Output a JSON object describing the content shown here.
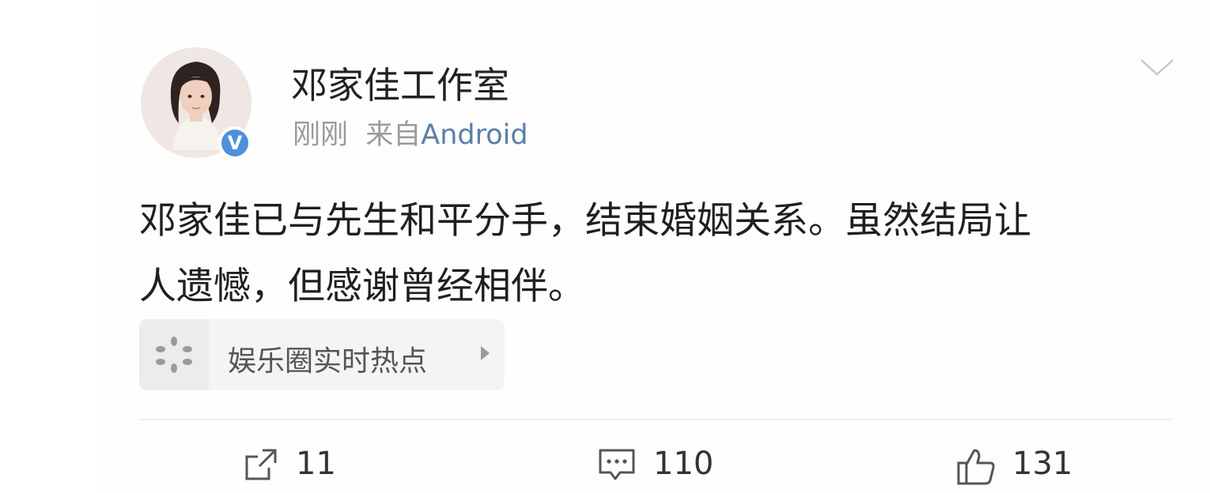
{
  "post": {
    "author": "邓家佳工作室",
    "time": "刚刚",
    "source_prefix": "来自",
    "source": "Android",
    "verified_mark": "V",
    "content_line1": "邓家佳已与先生和平分手，结束婚姻关系。虽然结局让",
    "content_line2": "人遗憾，但感谢曾经相伴。",
    "topic": "娱乐圈实时热点"
  },
  "actions": {
    "repost_count": "11",
    "comment_count": "110",
    "like_count": "131"
  },
  "icons": {
    "menu": "chevron-down-icon",
    "topic": "sparkle-dots-icon",
    "topic_arrow": "triangle-right-icon",
    "repost": "share-icon",
    "comment": "comment-icon",
    "like": "thumbs-up-icon"
  },
  "colors": {
    "verified": "#4b91dd",
    "source_link": "#5b7fa8",
    "text": "#1f1f1f",
    "muted": "#9a9a9a"
  }
}
